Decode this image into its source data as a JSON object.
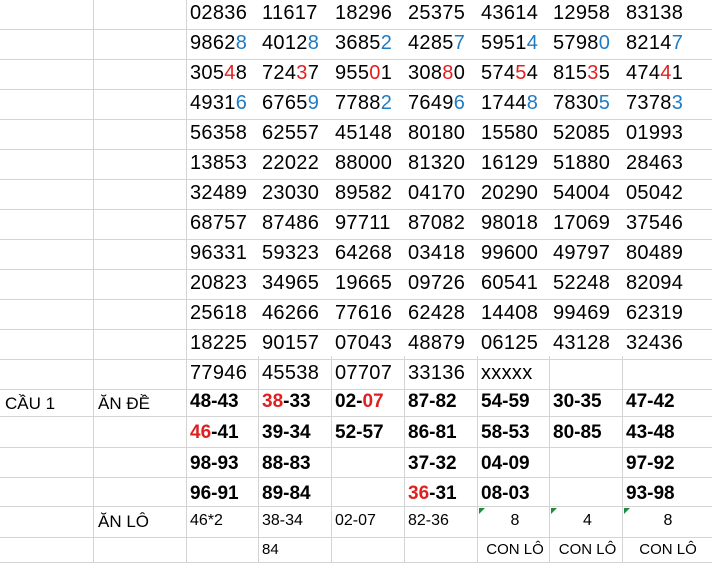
{
  "number_rows": [
    [
      [
        {
          "t": "02836"
        }
      ],
      [
        {
          "t": "11617"
        }
      ],
      [
        {
          "t": "18296"
        }
      ],
      [
        {
          "t": "25375"
        }
      ],
      [
        {
          "t": "43614"
        }
      ],
      [
        {
          "t": "12958"
        }
      ],
      [
        {
          "t": "83138"
        }
      ]
    ],
    [
      [
        {
          "t": "9862"
        },
        {
          "t": "8",
          "c": "blue"
        }
      ],
      [
        {
          "t": "4012"
        },
        {
          "t": "8",
          "c": "blue"
        }
      ],
      [
        {
          "t": "3685"
        },
        {
          "t": "2",
          "c": "blue"
        }
      ],
      [
        {
          "t": "4285"
        },
        {
          "t": "7",
          "c": "blue"
        }
      ],
      [
        {
          "t": "5951"
        },
        {
          "t": "4",
          "c": "blue"
        }
      ],
      [
        {
          "t": "5798"
        },
        {
          "t": "0",
          "c": "blue"
        }
      ],
      [
        {
          "t": "8214"
        },
        {
          "t": "7",
          "c": "blue"
        }
      ]
    ],
    [
      [
        {
          "t": "305"
        },
        {
          "t": "4",
          "c": "red"
        },
        {
          "t": "8"
        }
      ],
      [
        {
          "t": "724"
        },
        {
          "t": "3",
          "c": "red"
        },
        {
          "t": "7"
        }
      ],
      [
        {
          "t": "955"
        },
        {
          "t": "0",
          "c": "red"
        },
        {
          "t": "1"
        }
      ],
      [
        {
          "t": "308"
        },
        {
          "t": "8",
          "c": "red"
        },
        {
          "t": "0"
        }
      ],
      [
        {
          "t": "574"
        },
        {
          "t": "5",
          "c": "red"
        },
        {
          "t": "4"
        }
      ],
      [
        {
          "t": "815"
        },
        {
          "t": "3",
          "c": "red"
        },
        {
          "t": "5"
        }
      ],
      [
        {
          "t": "474"
        },
        {
          "t": "4",
          "c": "red"
        },
        {
          "t": "1"
        }
      ]
    ],
    [
      [
        {
          "t": "4931"
        },
        {
          "t": "6",
          "c": "blue"
        }
      ],
      [
        {
          "t": "6765"
        },
        {
          "t": "9",
          "c": "blue"
        }
      ],
      [
        {
          "t": "7788"
        },
        {
          "t": "2",
          "c": "blue"
        }
      ],
      [
        {
          "t": "7649"
        },
        {
          "t": "6",
          "c": "blue"
        }
      ],
      [
        {
          "t": "1744"
        },
        {
          "t": "8",
          "c": "blue"
        }
      ],
      [
        {
          "t": "7830"
        },
        {
          "t": "5",
          "c": "blue"
        }
      ],
      [
        {
          "t": "7378"
        },
        {
          "t": "3",
          "c": "blue"
        }
      ]
    ],
    [
      [
        {
          "t": "56358"
        }
      ],
      [
        {
          "t": "62557"
        }
      ],
      [
        {
          "t": "45148"
        }
      ],
      [
        {
          "t": "80180"
        }
      ],
      [
        {
          "t": "15580"
        }
      ],
      [
        {
          "t": "52085"
        }
      ],
      [
        {
          "t": "01993"
        }
      ]
    ],
    [
      [
        {
          "t": "13853"
        }
      ],
      [
        {
          "t": "22022"
        }
      ],
      [
        {
          "t": "88000"
        }
      ],
      [
        {
          "t": "81320"
        }
      ],
      [
        {
          "t": "16129"
        }
      ],
      [
        {
          "t": "51880"
        }
      ],
      [
        {
          "t": "28463"
        }
      ]
    ],
    [
      [
        {
          "t": "32489"
        }
      ],
      [
        {
          "t": "23030"
        }
      ],
      [
        {
          "t": "89582"
        }
      ],
      [
        {
          "t": "04170"
        }
      ],
      [
        {
          "t": "20290"
        }
      ],
      [
        {
          "t": "54004"
        }
      ],
      [
        {
          "t": "05042"
        }
      ]
    ],
    [
      [
        {
          "t": "68757"
        }
      ],
      [
        {
          "t": "87486"
        }
      ],
      [
        {
          "t": "97711"
        }
      ],
      [
        {
          "t": "87082"
        }
      ],
      [
        {
          "t": "98018"
        }
      ],
      [
        {
          "t": "17069"
        }
      ],
      [
        {
          "t": "37546"
        }
      ]
    ],
    [
      [
        {
          "t": "96331"
        }
      ],
      [
        {
          "t": "59323"
        }
      ],
      [
        {
          "t": "64268"
        }
      ],
      [
        {
          "t": "03418"
        }
      ],
      [
        {
          "t": "99600"
        }
      ],
      [
        {
          "t": "49797"
        }
      ],
      [
        {
          "t": "80489"
        }
      ]
    ],
    [
      [
        {
          "t": "20823"
        }
      ],
      [
        {
          "t": "34965"
        }
      ],
      [
        {
          "t": "19665"
        }
      ],
      [
        {
          "t": "09726"
        }
      ],
      [
        {
          "t": "60541"
        }
      ],
      [
        {
          "t": "52248"
        }
      ],
      [
        {
          "t": "82094"
        }
      ]
    ],
    [
      [
        {
          "t": "25618"
        }
      ],
      [
        {
          "t": "46266"
        }
      ],
      [
        {
          "t": "77616"
        }
      ],
      [
        {
          "t": "62428"
        }
      ],
      [
        {
          "t": "14408"
        }
      ],
      [
        {
          "t": "99469"
        }
      ],
      [
        {
          "t": "62319"
        }
      ]
    ],
    [
      [
        {
          "t": "18225"
        }
      ],
      [
        {
          "t": "90157"
        }
      ],
      [
        {
          "t": "07043"
        }
      ],
      [
        {
          "t": "48879"
        }
      ],
      [
        {
          "t": "06125"
        }
      ],
      [
        {
          "t": "43128"
        }
      ],
      [
        {
          "t": "32436"
        }
      ]
    ],
    [
      [
        {
          "t": "77946"
        }
      ],
      [
        {
          "t": "45538"
        }
      ],
      [
        {
          "t": "07707"
        }
      ],
      [
        {
          "t": "33136"
        }
      ],
      [
        {
          "t": "xxxxx"
        }
      ]
    ]
  ],
  "labels": {
    "cau": "CẦU 1",
    "an_de": "ĂN ĐỀ",
    "an_lo": "ĂN LÔ"
  },
  "de_pairs": [
    [
      [
        {
          "t": "48-43"
        }
      ],
      [
        {
          "t": "38",
          "c": "red"
        },
        {
          "t": "-33"
        }
      ],
      [
        {
          "t": "02-"
        },
        {
          "t": "07",
          "c": "red"
        }
      ],
      [
        {
          "t": "87-82"
        }
      ],
      [
        {
          "t": "54-59"
        }
      ],
      [
        {
          "t": "30-35"
        }
      ],
      [
        {
          "t": "47-42"
        }
      ]
    ],
    [
      [
        {
          "t": "46",
          "c": "red"
        },
        {
          "t": "-41"
        }
      ],
      [
        {
          "t": "39-34"
        }
      ],
      [
        {
          "t": "52-57"
        }
      ],
      [
        {
          "t": "86-81"
        }
      ],
      [
        {
          "t": "58-53"
        }
      ],
      [
        {
          "t": "80-85"
        }
      ],
      [
        {
          "t": "43-48"
        }
      ]
    ],
    [
      [
        {
          "t": "98-93"
        }
      ],
      [
        {
          "t": "88-83"
        }
      ],
      [],
      [
        {
          "t": "37-32"
        }
      ],
      [
        {
          "t": "04-09"
        }
      ],
      [],
      [
        {
          "t": "97-92"
        }
      ]
    ],
    [
      [
        {
          "t": "96-91"
        }
      ],
      [
        {
          "t": "89-84"
        }
      ],
      [],
      [
        {
          "t": "36",
          "c": "red"
        },
        {
          "t": "-31"
        }
      ],
      [
        {
          "t": "08-03"
        }
      ],
      [],
      [
        {
          "t": "93-98"
        }
      ]
    ]
  ],
  "lo_row": [
    "46*2",
    "38-34",
    "02-07",
    "82-36",
    "8",
    "4",
    "8"
  ],
  "bottom_row": [
    "",
    "84",
    "",
    "",
    "CON LÔ",
    "CON LÔ",
    "CON LÔ"
  ]
}
